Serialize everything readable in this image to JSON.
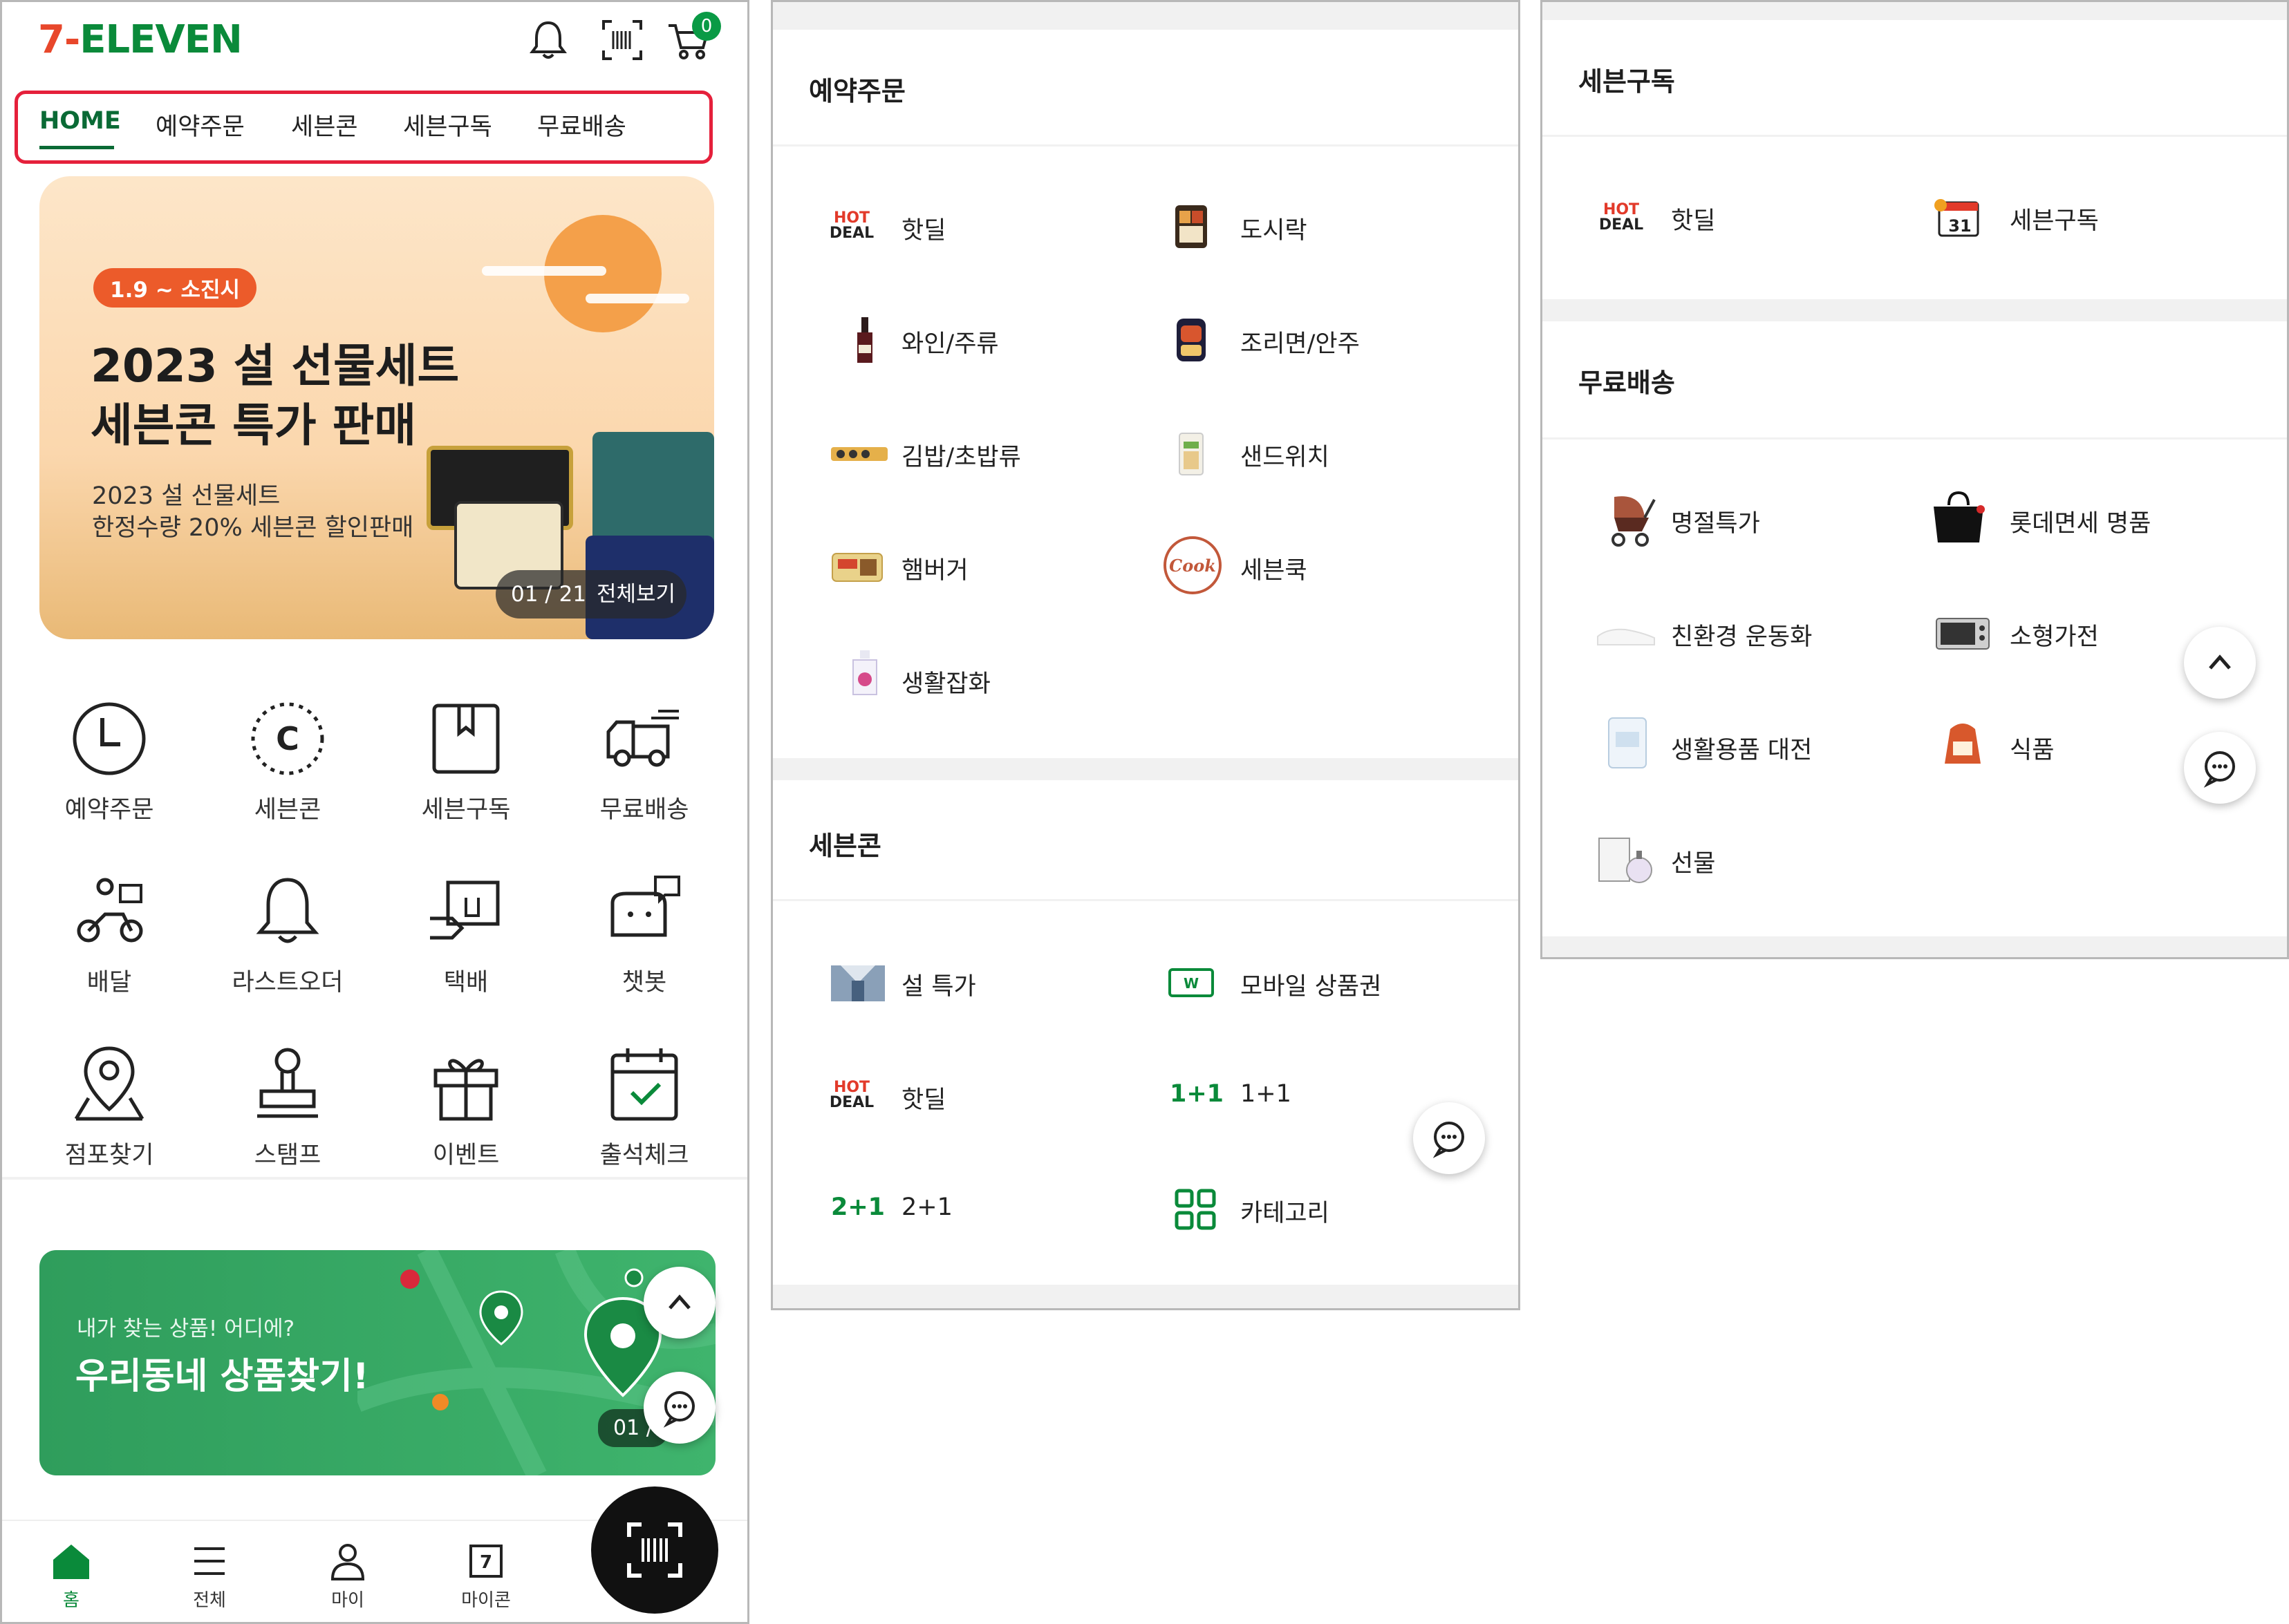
{
  "header": {
    "logo": "7-ELEVEN",
    "cart_count": "0"
  },
  "tabs": [
    {
      "label": "HOME",
      "active": true
    },
    {
      "label": "예약주문"
    },
    {
      "label": "세븐콘"
    },
    {
      "label": "세븐구독"
    },
    {
      "label": "무료배송"
    }
  ],
  "banner": {
    "date_badge": "1.9 ~ 소진시",
    "title_line1": "2023 설 선물세트",
    "title_line2": "세븐콘 특가 판매",
    "sub_line1": "2023 설 선물세트",
    "sub_line2": "한정수량 20% 세븐콘 할인판매",
    "pager": "01 / 21",
    "view_all": "전체보기"
  },
  "quick_menu": [
    {
      "label": "예약주문",
      "icon": "clock-icon"
    },
    {
      "label": "세븐콘",
      "icon": "coupon-c-icon"
    },
    {
      "label": "세븐구독",
      "icon": "book-icon"
    },
    {
      "label": "무료배송",
      "icon": "truck-icon"
    },
    {
      "label": "배달",
      "icon": "scooter-icon"
    },
    {
      "label": "라스트오더",
      "icon": "bell-icon"
    },
    {
      "label": "택배",
      "icon": "parcel-icon"
    },
    {
      "label": "챗봇",
      "icon": "chatbot-icon"
    },
    {
      "label": "점포찾기",
      "icon": "map-pin-icon"
    },
    {
      "label": "스탬프",
      "icon": "stamp-icon"
    },
    {
      "label": "이벤트",
      "icon": "gift-icon"
    },
    {
      "label": "출석체크",
      "icon": "calendar-check-icon"
    }
  ],
  "map_banner": {
    "small": "내가 찾는 상품! 어디에?",
    "big": "우리동네 상품찾기!",
    "pager": "01 /"
  },
  "bottom_nav": [
    {
      "label": "홈",
      "active": true
    },
    {
      "label": "전체"
    },
    {
      "label": "마이"
    },
    {
      "label": "마이콘"
    }
  ],
  "reserve": {
    "title": "예약주문",
    "items": [
      "핫딜",
      "도시락",
      "와인/주류",
      "조리면/안주",
      "김밥/초밥류",
      "샌드위치",
      "햄버거",
      "세븐쿡",
      "생활잡화"
    ]
  },
  "sevencon": {
    "title": "세븐콘",
    "items": [
      "설 특가",
      "모바일 상품권",
      "핫딜",
      "1+1",
      "2+1",
      "카테고리"
    ],
    "badge_1p1": "1+1",
    "badge_2p1": "2+1"
  },
  "subscribe": {
    "title": "세븐구독",
    "items": [
      "핫딜",
      "세븐구독"
    ],
    "calendar_num": "31"
  },
  "free_delivery": {
    "title": "무료배송",
    "items": [
      "명절특가",
      "롯데면세 명품",
      "친환경 운동화",
      "소형가전",
      "생활용품 대전",
      "식품",
      "선물"
    ]
  },
  "hotdeal_logo": {
    "hot": "HOT",
    "deal": "DEAL"
  },
  "colors": {
    "brand_green": "#0a8a3a",
    "brand_orange": "#e8472b",
    "tab_outline": "#e5203b"
  }
}
